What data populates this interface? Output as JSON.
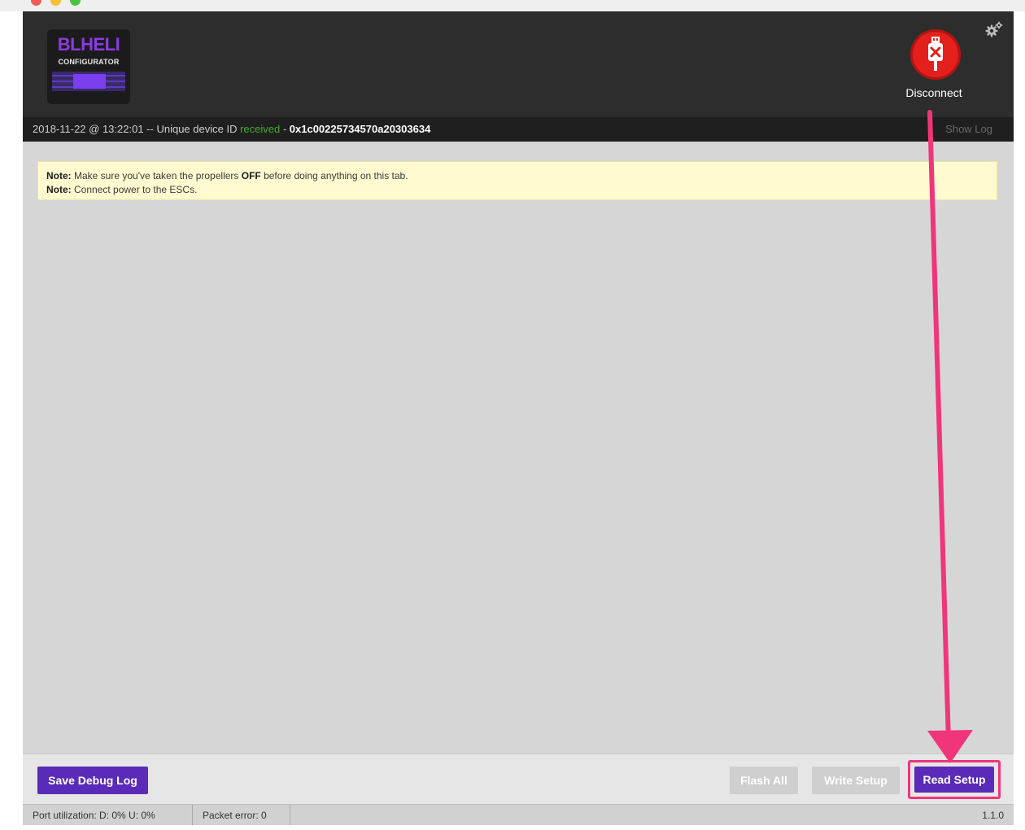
{
  "app": {
    "logo_title": "BLHELI",
    "logo_subtitle": "CONFIGURATOR"
  },
  "header": {
    "disconnect_label": "Disconnect",
    "settings_icon": "gear-icon",
    "disconnect_icon": "usb-disconnect-icon"
  },
  "infobar": {
    "timestamp": "2018-11-22 @ 13:22:01",
    "separator": " -- ",
    "device_text": "Unique device ID",
    "received": "received",
    "dash": " - ",
    "device_id": "0x1c00225734570a20303634",
    "show_log": "Show Log"
  },
  "notes": [
    {
      "label": "Note:",
      "pre": " Make sure you've taken the propellers ",
      "emphasis": "OFF",
      "post": " before doing anything on this tab."
    },
    {
      "label": "Note:",
      "pre": " Connect power to the ESCs.",
      "emphasis": "",
      "post": ""
    }
  ],
  "footer": {
    "save_debug_log": "Save Debug Log",
    "flash_all": "Flash All",
    "write_setup": "Write Setup",
    "read_setup": "Read Setup"
  },
  "status": {
    "port_utilization": "Port utilization: D: 0% U: 0%",
    "packet_error": "Packet error: 0",
    "version": "1.1.0"
  },
  "colors": {
    "accent_purple": "#5a2bb8",
    "disconnect_red": "#e3201b",
    "received_green": "#3fae2a",
    "annotation_pink": "#f0357a",
    "note_bg": "#fffacf"
  }
}
